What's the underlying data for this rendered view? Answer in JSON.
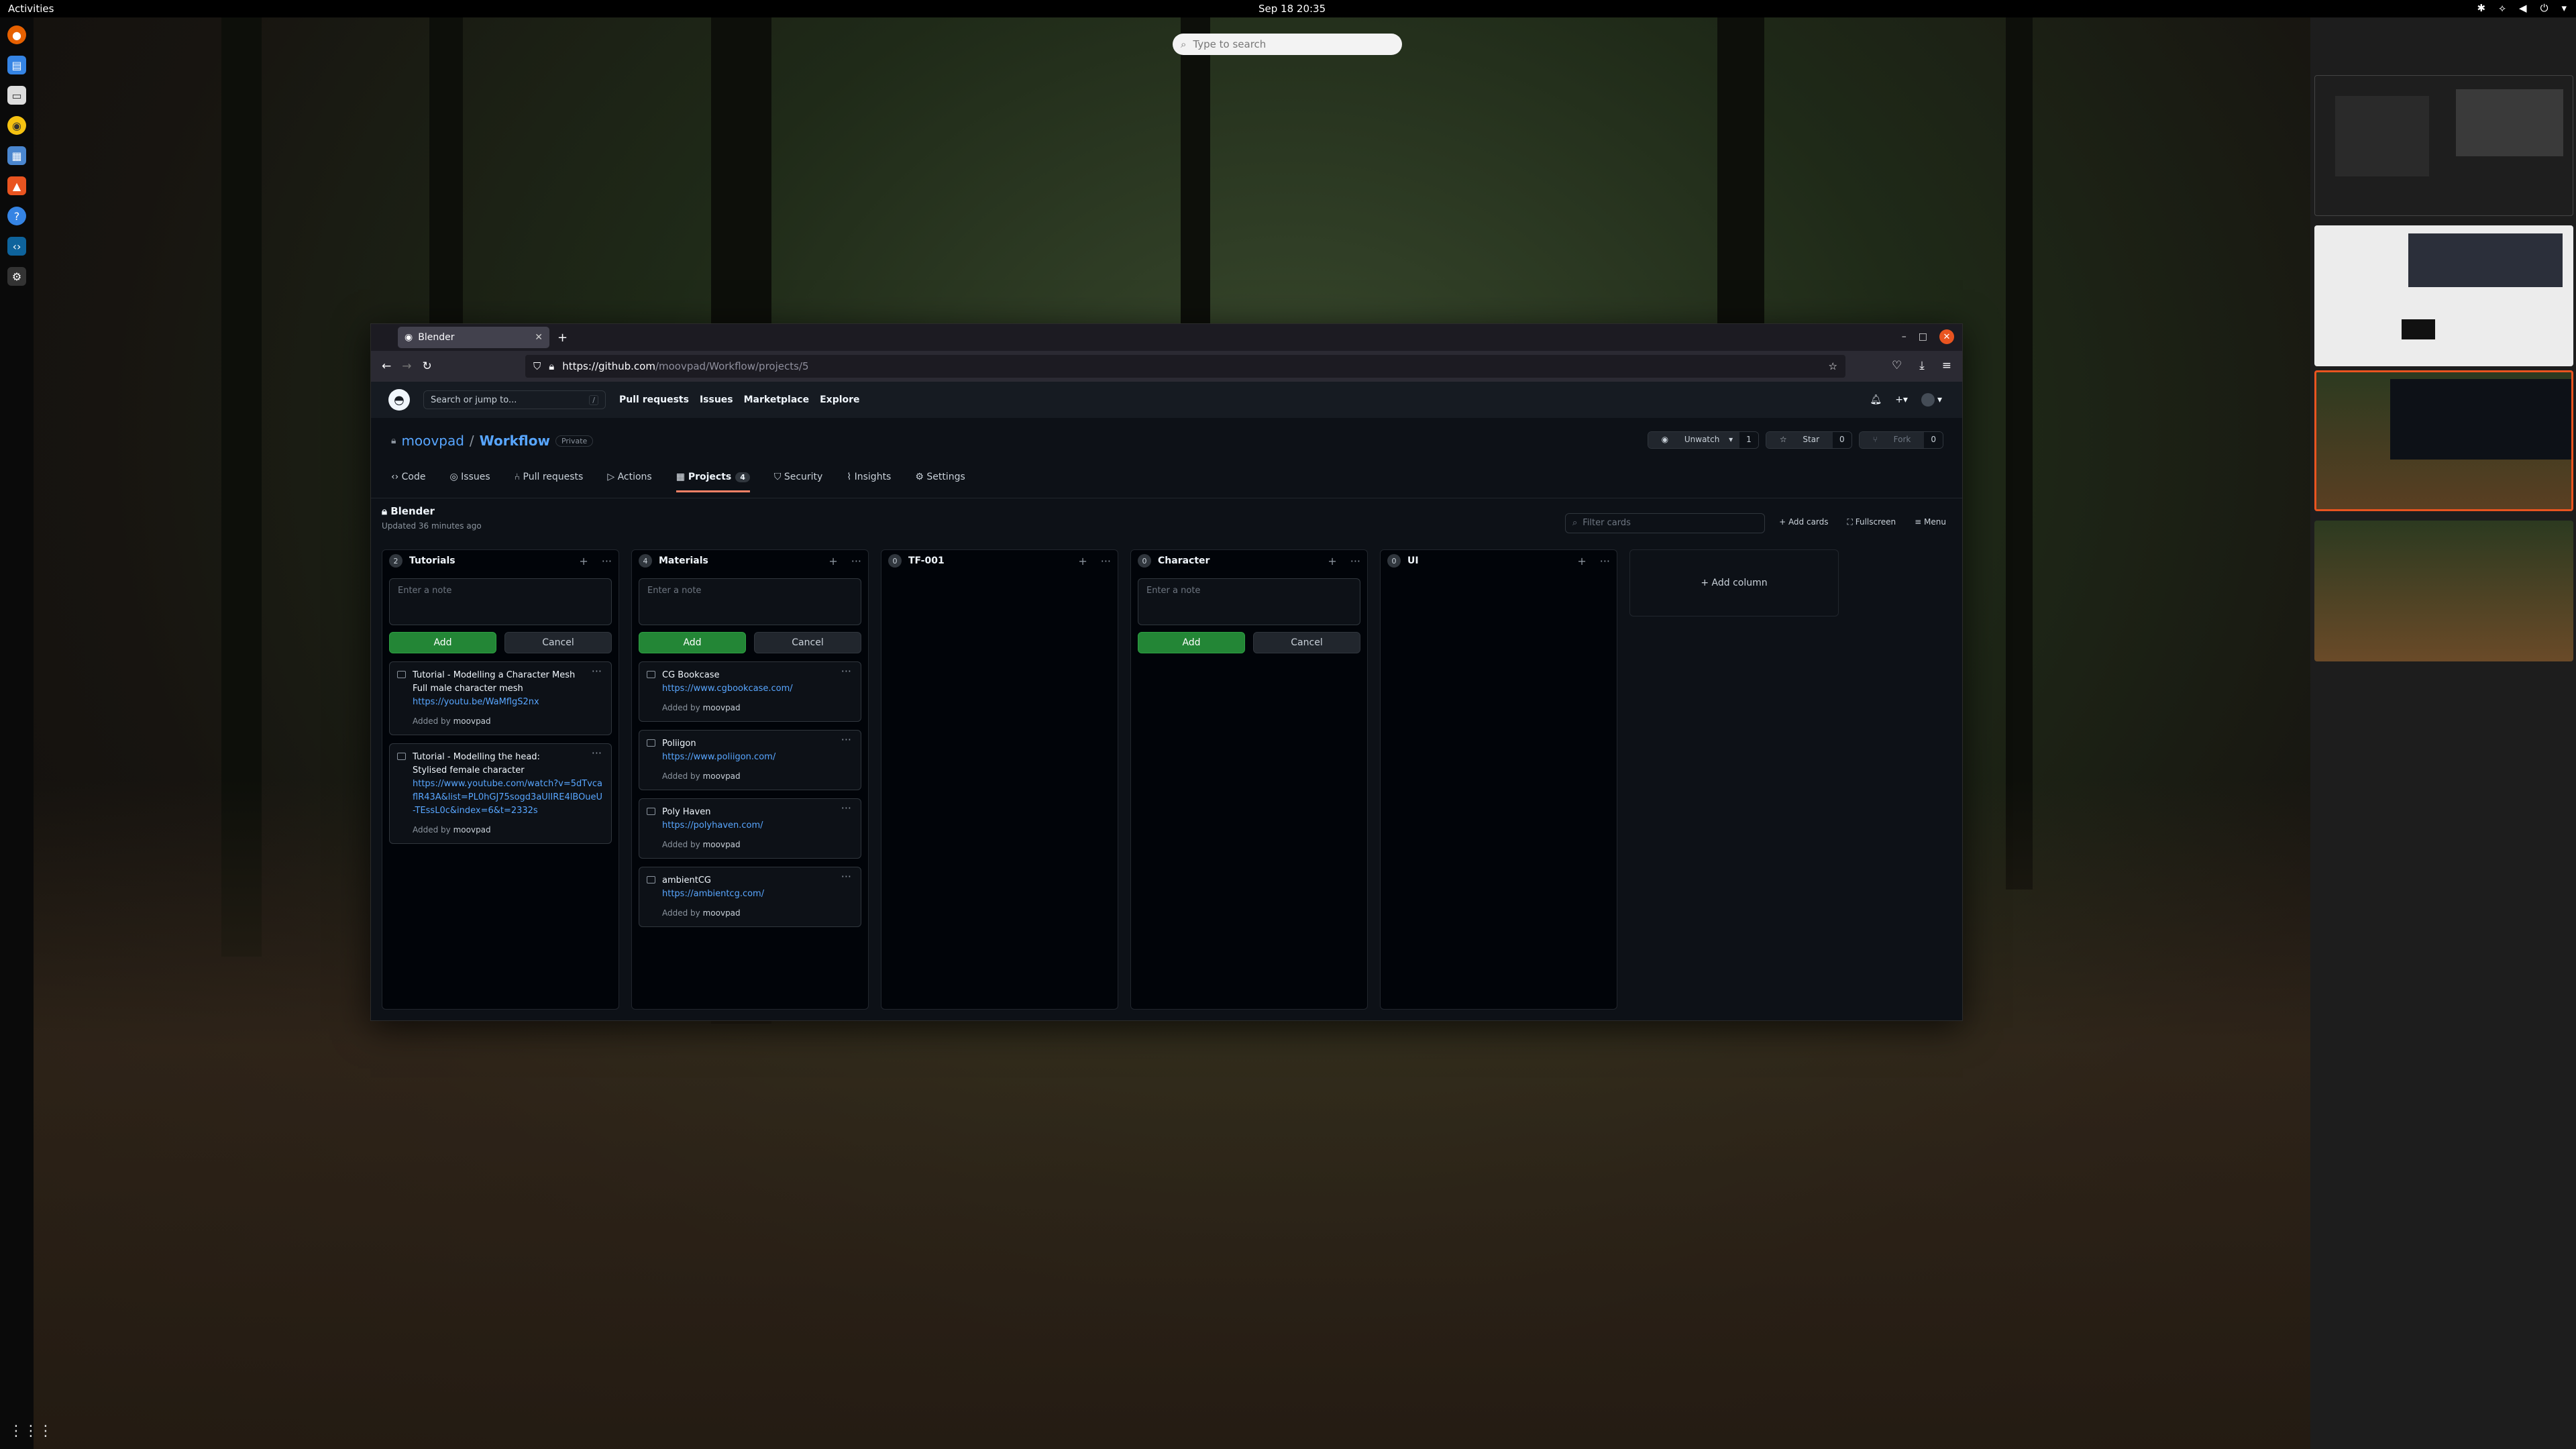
{
  "topbar": {
    "activities": "Activities",
    "clock": "Sep 18  20:35"
  },
  "overview": {
    "search_placeholder": "Type to search"
  },
  "browser": {
    "tab_title": "Blender",
    "url_host": "https://github.com",
    "url_path": "/moovpad/Workflow/projects/5"
  },
  "github": {
    "search_placeholder": "Search or jump to...",
    "search_key": "/",
    "nav": [
      "Pull requests",
      "Issues",
      "Marketplace",
      "Explore"
    ],
    "repo_owner": "moovpad",
    "repo_sep": "/",
    "repo_name": "Workflow",
    "repo_visibility": "Private",
    "buttons": {
      "unwatch": "Unwatch",
      "unwatch_count": "1",
      "star": "Star",
      "star_count": "0",
      "fork": "Fork",
      "fork_count": "0"
    },
    "repo_tabs": [
      "Code",
      "Issues",
      "Pull requests",
      "Actions",
      "Projects",
      "Security",
      "Insights",
      "Settings"
    ],
    "projects_count": "4"
  },
  "project": {
    "name": "Blender",
    "updated": "Updated 36 minutes ago",
    "filter_placeholder": "Filter cards",
    "add_cards": "Add cards",
    "fullscreen": "Fullscreen",
    "menu": "Menu",
    "add_column": "+ Add column",
    "note_placeholder": "Enter a note",
    "add_label": "Add",
    "cancel_label": "Cancel",
    "added_by": "Added by",
    "user": "moovpad",
    "columns": [
      {
        "name": "Tutorials",
        "count": "2"
      },
      {
        "name": "Materials",
        "count": "4"
      },
      {
        "name": "TF-001",
        "count": "0"
      },
      {
        "name": "Character",
        "count": "0"
      },
      {
        "name": "UI",
        "count": "0"
      }
    ],
    "tutorial_cards": [
      {
        "title": "Tutorial - Modelling a Character Mesh",
        "desc": "Full male character mesh",
        "link": "https://youtu.be/WaMflgS2nx"
      },
      {
        "title": "Tutorial - Modelling the head:",
        "desc": "Stylised female character",
        "link": "https://www.youtube.com/watch?v=5dTvcaflR43A&list=PL0hGJ75sogd3aUlIRE4lBOueU-TEssL0c&index=6&t=2332s"
      }
    ],
    "material_cards": [
      {
        "title": "CG Bookcase",
        "link": "https://www.cgbookcase.com/"
      },
      {
        "title": "Poliigon",
        "link": "https://www.poliigon.com/"
      },
      {
        "title": "Poly Haven",
        "link": "https://polyhaven.com/"
      },
      {
        "title": "ambientCG",
        "link": "https://ambientcg.com/"
      }
    ]
  }
}
